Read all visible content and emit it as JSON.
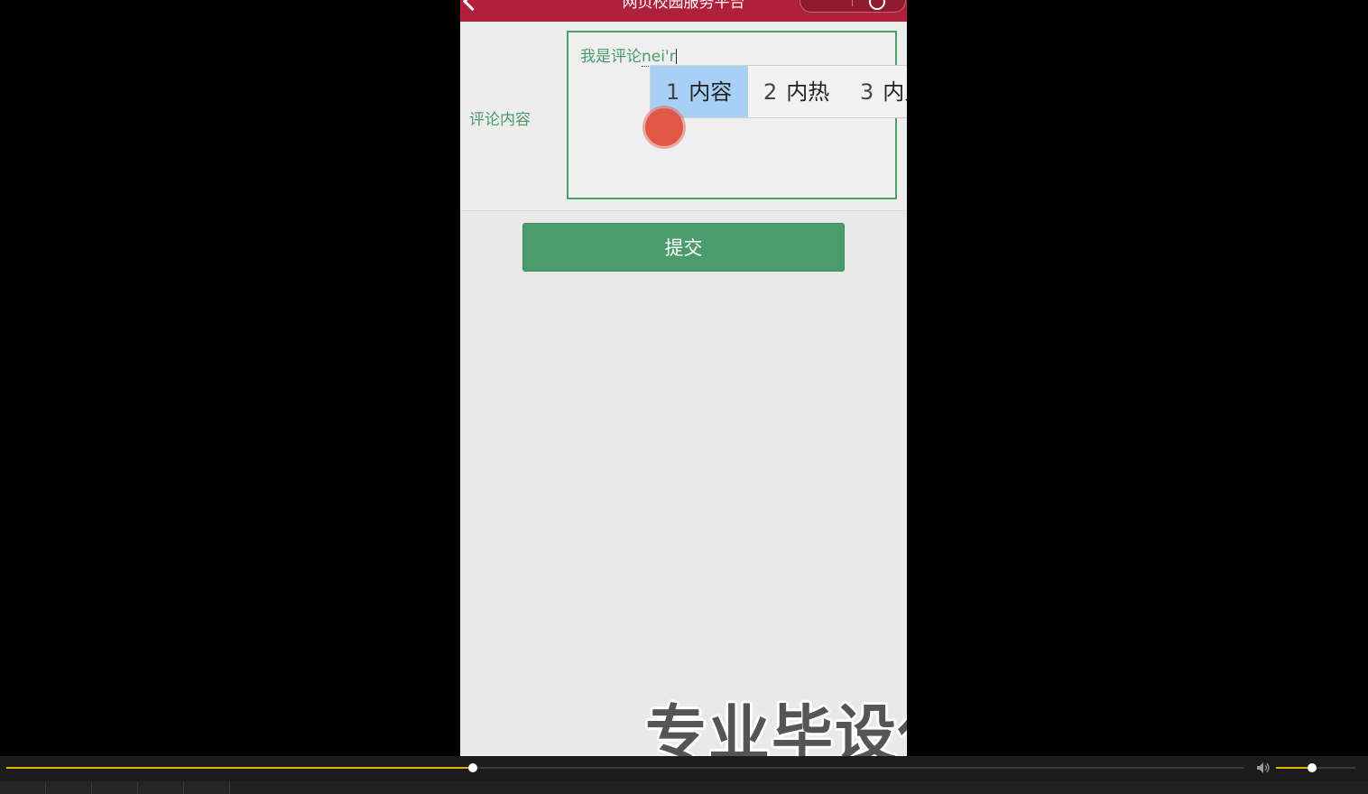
{
  "app": {
    "header_title": "网页校园服务平台"
  },
  "form": {
    "content_label": "评论内容",
    "textarea_committed": "我是评论",
    "textarea_composing": "nei'r",
    "submit_label": "提交"
  },
  "ime": {
    "candidates": [
      {
        "num": "1",
        "text": "内容",
        "selected": true
      },
      {
        "num": "2",
        "text": "内热",
        "selected": false
      },
      {
        "num": "3",
        "text": "内人",
        "selected": false
      }
    ]
  },
  "watermark": {
    "text": "专业毕设代"
  },
  "player": {
    "progress_fraction": 0.377,
    "volume_fraction": 0.45
  },
  "colors": {
    "header_bg": "#b0203a",
    "accent_green": "#4a9c6d",
    "ime_selected": "#a8d0f7",
    "progress": "#e6b400"
  },
  "icons": {
    "back": "chevron-left-icon",
    "capsule": "more-close-capsule-icon",
    "volume": "speaker-icon"
  }
}
